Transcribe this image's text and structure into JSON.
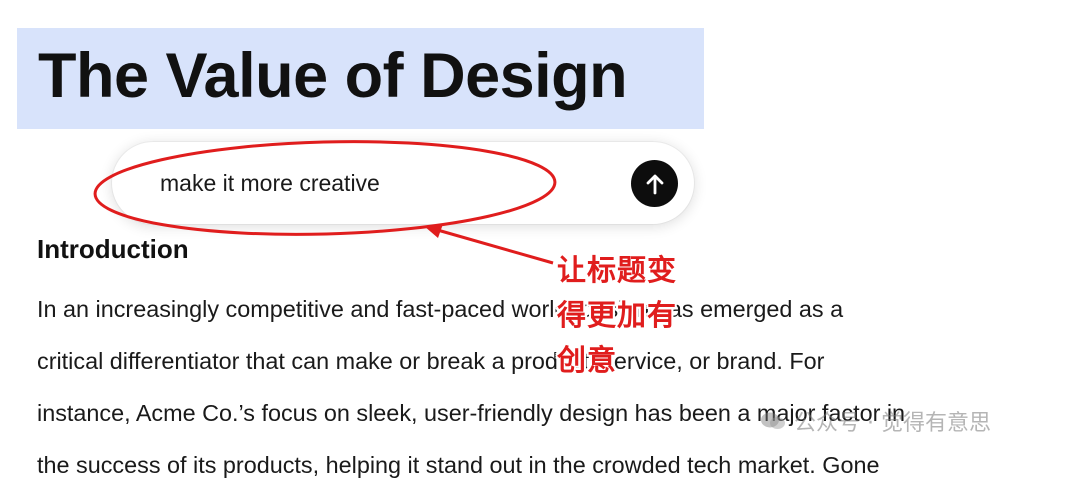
{
  "document": {
    "title": "The Value of Design",
    "section_heading": "Introduction",
    "body_lines": [
      "In an increasingly competitive and fast-paced world, design has emerged as a",
      "critical differentiator that can make or break a product, service, or brand. For",
      "instance, Acme Co.’s focus on sleek, user-friendly design has been a major factor in",
      "the success of its products, helping it stand out in the crowded tech market. Gone"
    ]
  },
  "prompt": {
    "value": "make it more creative",
    "send_icon": "arrow-up-icon"
  },
  "annotation": {
    "lines": [
      "让标题变",
      "得更加有",
      "创意"
    ],
    "color": "#e01d1d"
  },
  "watermark": {
    "text": "公众号 · 觉得有意思"
  },
  "colors": {
    "title_highlight": "#d8e3fb",
    "send_button": "#0d0d0d",
    "annotation_red": "#e01d1d"
  }
}
